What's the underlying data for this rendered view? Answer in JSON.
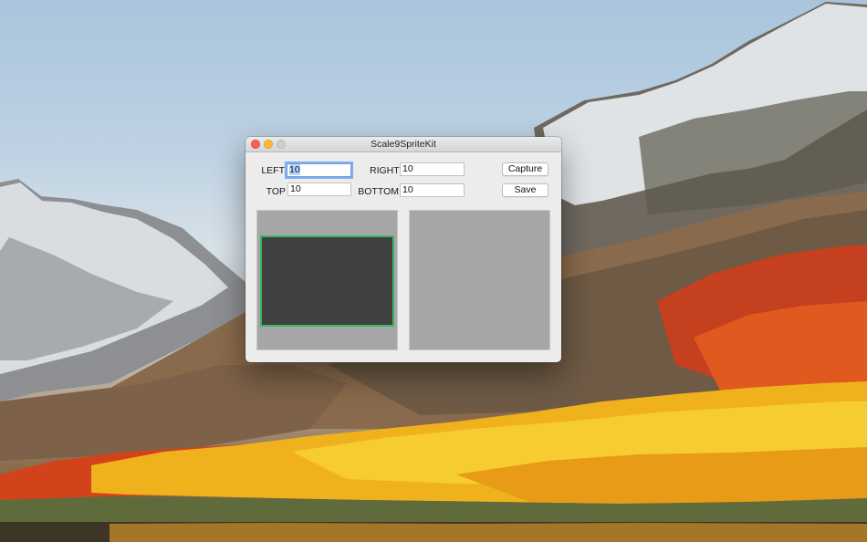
{
  "window": {
    "title": "Scale9SpriteKit"
  },
  "insets": {
    "left_label": "LEFT",
    "left_value": "10",
    "right_label": "RIGHT",
    "right_value": "10",
    "top_label": "TOP",
    "top_value": "10",
    "bottom_label": "BOTTOM",
    "bottom_value": "10"
  },
  "buttons": {
    "capture_label": "Capture",
    "save_label": "Save"
  },
  "colors": {
    "close": "#fc5f57",
    "minimize": "#fdbc2e",
    "zoom_disabled": "#d0d0d0",
    "focus_ring": "#7fb0ee",
    "panel_background": "#a6a6a6",
    "sprite_fill": "#404040",
    "sprite_border": "#3db85a"
  },
  "icons": {
    "close": "close-icon",
    "minimize": "minimize-icon",
    "zoom": "zoom-icon"
  }
}
